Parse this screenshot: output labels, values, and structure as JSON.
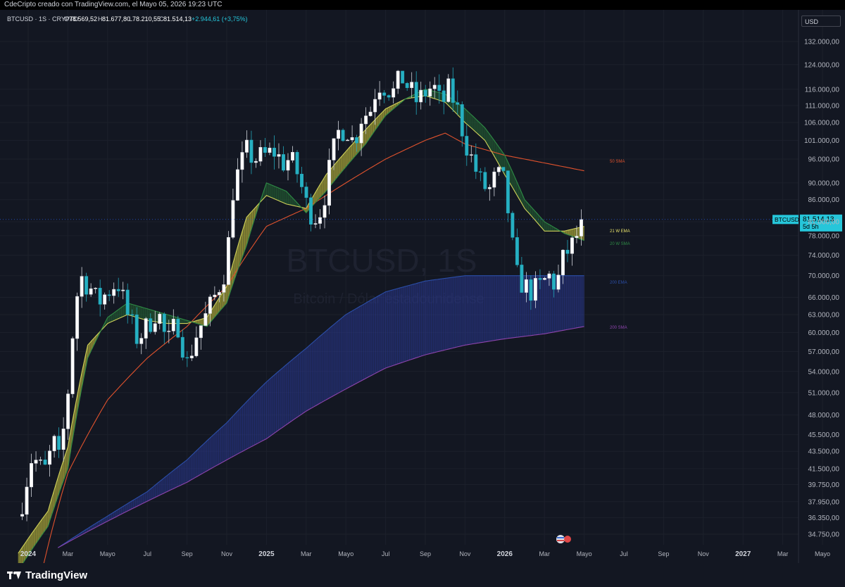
{
  "header": {
    "title": "CdeCripto creado con TradingView.com, el Mayo 05, 2026 19:23 UTC"
  },
  "legend": {
    "symbol": "BTCUSD · 1S · CRYPTO",
    "o_label": "O",
    "o_value": "78.569,52",
    "h_label": "H",
    "h_value": "81.677,80",
    "l_label": "L",
    "l_value": "78.210,55",
    "c_label": "C",
    "c_value": "81.514,13",
    "change": "+2.944,61 (+3,75%)"
  },
  "currency": "USD",
  "watermark": {
    "symbol": "BTCUSD, 1S",
    "description": "Bitcoin / Dólar estadounidense"
  },
  "price_tag": {
    "symbol": "BTCUSD",
    "price": "81.514,13",
    "countdown": "5d 5h"
  },
  "indicator_labels": [
    {
      "text": "50 SMA",
      "color": "#e0522d"
    },
    {
      "text": "21 W EMA",
      "color": "#e8e36b"
    },
    {
      "text": "20 W SMA",
      "color": "#2e8b45"
    },
    {
      "text": "200 EMA",
      "color": "#2b4ea8"
    },
    {
      "text": "200 SMA",
      "color": "#8e44ad"
    }
  ],
  "footer": {
    "brand": "TradingView"
  },
  "chart_data": {
    "type": "candlestick",
    "scale": "log",
    "ylim": [
      33500,
      142000
    ],
    "yticks": [
      "132.000,00",
      "124.000,00",
      "116.000,00",
      "111.000,00",
      "106.000,00",
      "101.000,00",
      "96.000,00",
      "90.000,00",
      "86.000,00",
      "81.000,00",
      "78.000,00",
      "74.000,00",
      "70.000,00",
      "66.000,00",
      "63.000,00",
      "60.000,00",
      "57.000,00",
      "54.000,00",
      "51.000,00",
      "48.000,00",
      "45.500,00",
      "43.500,00",
      "41.500,00",
      "39.750,00",
      "37.950,00",
      "36.350,00",
      "34.750,00"
    ],
    "xticks": [
      {
        "label": "2024",
        "t": 0,
        "year": true
      },
      {
        "label": "Mar",
        "t": 2,
        "year": false
      },
      {
        "label": "Mayo",
        "t": 4,
        "year": false
      },
      {
        "label": "Jul",
        "t": 6,
        "year": false
      },
      {
        "label": "Sep",
        "t": 8,
        "year": false
      },
      {
        "label": "Nov",
        "t": 10,
        "year": false
      },
      {
        "label": "2025",
        "t": 12,
        "year": true
      },
      {
        "label": "Mar",
        "t": 14,
        "year": false
      },
      {
        "label": "Mayo",
        "t": 16,
        "year": false
      },
      {
        "label": "Jul",
        "t": 18,
        "year": false
      },
      {
        "label": "Sep",
        "t": 20,
        "year": false
      },
      {
        "label": "Nov",
        "t": 22,
        "year": false
      },
      {
        "label": "2026",
        "t": 24,
        "year": true
      },
      {
        "label": "Mar",
        "t": 26,
        "year": false
      },
      {
        "label": "Mayo",
        "t": 28,
        "year": false
      },
      {
        "label": "Jul",
        "t": 30,
        "year": false
      },
      {
        "label": "Sep",
        "t": 32,
        "year": false
      },
      {
        "label": "Nov",
        "t": 34,
        "year": false
      },
      {
        "label": "2027",
        "t": 36,
        "year": true
      },
      {
        "label": "Mar",
        "t": 38,
        "year": false
      },
      {
        "label": "Mayo",
        "t": 40,
        "year": false
      }
    ],
    "close_anchors": [
      [
        -0.3,
        38000
      ],
      [
        0.2,
        43000
      ],
      [
        0.8,
        41000
      ],
      [
        1.3,
        44500
      ],
      [
        1.6,
        42000
      ],
      [
        2.0,
        51000
      ],
      [
        2.3,
        62000
      ],
      [
        2.6,
        70000
      ],
      [
        3.1,
        68000
      ],
      [
        3.5,
        65000
      ],
      [
        4.0,
        67000
      ],
      [
        4.5,
        69000
      ],
      [
        5.0,
        63000
      ],
      [
        5.5,
        59000
      ],
      [
        6.0,
        61000
      ],
      [
        6.5,
        64000
      ],
      [
        7.0,
        58000
      ],
      [
        7.5,
        62000
      ],
      [
        8.0,
        55000
      ],
      [
        8.5,
        60000
      ],
      [
        9.0,
        63000
      ],
      [
        9.5,
        67000
      ],
      [
        10.0,
        72000
      ],
      [
        10.3,
        88000
      ],
      [
        10.6,
        93000
      ],
      [
        11.0,
        98000
      ],
      [
        11.4,
        96000
      ],
      [
        12.0,
        97000
      ],
      [
        12.4,
        98000
      ],
      [
        12.8,
        95000
      ],
      [
        13.2,
        96000
      ],
      [
        13.6,
        92000
      ],
      [
        14.0,
        85000
      ],
      [
        14.4,
        82000
      ],
      [
        14.8,
        84000
      ],
      [
        15.2,
        94000
      ],
      [
        15.6,
        103000
      ],
      [
        16.0,
        105000
      ],
      [
        16.4,
        100000
      ],
      [
        16.8,
        108000
      ],
      [
        17.2,
        109000
      ],
      [
        17.6,
        118000
      ],
      [
        18.0,
        117000
      ],
      [
        18.4,
        115000
      ],
      [
        18.8,
        120000
      ],
      [
        19.2,
        116000
      ],
      [
        19.6,
        112000
      ],
      [
        20.0,
        115000
      ],
      [
        20.4,
        117000
      ],
      [
        20.8,
        111000
      ],
      [
        21.2,
        116000
      ],
      [
        21.6,
        110000
      ],
      [
        22.0,
        101000
      ],
      [
        22.4,
        95000
      ],
      [
        22.8,
        90000
      ],
      [
        23.2,
        88000
      ],
      [
        23.6,
        92000
      ],
      [
        24.0,
        90000
      ],
      [
        24.3,
        78000
      ],
      [
        24.6,
        70000
      ],
      [
        25.0,
        68000
      ],
      [
        25.4,
        67000
      ],
      [
        25.8,
        68000
      ],
      [
        26.2,
        70000
      ],
      [
        26.6,
        68000
      ],
      [
        27.0,
        74000
      ],
      [
        27.4,
        76000
      ],
      [
        27.7,
        78570
      ],
      [
        27.9,
        81514
      ]
    ],
    "series": [
      {
        "name": "50 SMA",
        "color": "#e0522d",
        "values": [
          [
            0.5,
            30000
          ],
          [
            2,
            41000
          ],
          [
            4,
            50000
          ],
          [
            6,
            56000
          ],
          [
            8,
            61000
          ],
          [
            10,
            68000
          ],
          [
            12,
            80000
          ],
          [
            14,
            84000
          ],
          [
            16,
            90000
          ],
          [
            18,
            96000
          ],
          [
            20,
            101000
          ],
          [
            21,
            103000
          ],
          [
            22,
            100000
          ],
          [
            24,
            97000
          ],
          [
            26,
            95000
          ],
          [
            28,
            93000
          ]
        ]
      },
      {
        "name": "21 W EMA",
        "color": "#cfd05a",
        "values": [
          [
            -0.5,
            33000
          ],
          [
            1,
            37000
          ],
          [
            2,
            44000
          ],
          [
            3,
            58000
          ],
          [
            4,
            61500
          ],
          [
            5,
            63000
          ],
          [
            6,
            62000
          ],
          [
            7,
            61500
          ],
          [
            8,
            61500
          ],
          [
            9,
            62500
          ],
          [
            10,
            68000
          ],
          [
            11,
            82000
          ],
          [
            12,
            87000
          ],
          [
            13,
            85000
          ],
          [
            14,
            84000
          ],
          [
            15,
            92000
          ],
          [
            16,
            98000
          ],
          [
            17,
            104000
          ],
          [
            18,
            110000
          ],
          [
            19,
            113000
          ],
          [
            20,
            114000
          ],
          [
            21,
            112000
          ],
          [
            22,
            106000
          ],
          [
            23,
            101000
          ],
          [
            24,
            92000
          ],
          [
            25,
            84000
          ],
          [
            26,
            79000
          ],
          [
            27,
            79000
          ],
          [
            28,
            80000
          ]
        ]
      },
      {
        "name": "20 W SMA",
        "color": "#2e8b45",
        "values": [
          [
            -0.5,
            31500
          ],
          [
            1,
            35500
          ],
          [
            2,
            41500
          ],
          [
            3,
            56000
          ],
          [
            4,
            62500
          ],
          [
            5,
            65000
          ],
          [
            6,
            64000
          ],
          [
            7,
            63000
          ],
          [
            8,
            62000
          ],
          [
            9,
            61000
          ],
          [
            10,
            65000
          ],
          [
            11,
            76000
          ],
          [
            12,
            90000
          ],
          [
            13,
            88000
          ],
          [
            14,
            83000
          ],
          [
            15,
            88000
          ],
          [
            16,
            94000
          ],
          [
            17,
            100000
          ],
          [
            18,
            108000
          ],
          [
            19,
            113000
          ],
          [
            20,
            116000
          ],
          [
            21,
            114500
          ],
          [
            22,
            110000
          ],
          [
            23,
            104500
          ],
          [
            24,
            97000
          ],
          [
            25,
            86000
          ],
          [
            26,
            81000
          ],
          [
            27,
            78500
          ],
          [
            28,
            77000
          ]
        ]
      },
      {
        "name": "200 EMA",
        "color": "#2b4ea8",
        "values": [
          [
            1.5,
            33500
          ],
          [
            4,
            36500
          ],
          [
            6,
            39000
          ],
          [
            8,
            42500
          ],
          [
            10,
            47000
          ],
          [
            12,
            52500
          ],
          [
            14,
            57500
          ],
          [
            16,
            63000
          ],
          [
            18,
            67000
          ],
          [
            20,
            69000
          ],
          [
            22,
            70000
          ],
          [
            24,
            70000
          ],
          [
            26,
            70000
          ],
          [
            28,
            70000
          ]
        ]
      },
      {
        "name": "200 SMA",
        "color": "#8e44ad",
        "values": [
          [
            1.5,
            33500
          ],
          [
            4,
            36000
          ],
          [
            6,
            38000
          ],
          [
            8,
            40000
          ],
          [
            10,
            42500
          ],
          [
            12,
            45000
          ],
          [
            14,
            48500
          ],
          [
            16,
            51500
          ],
          [
            18,
            54500
          ],
          [
            20,
            56500
          ],
          [
            22,
            58000
          ],
          [
            24,
            59000
          ],
          [
            26,
            59800
          ],
          [
            28,
            61000
          ]
        ]
      }
    ]
  }
}
